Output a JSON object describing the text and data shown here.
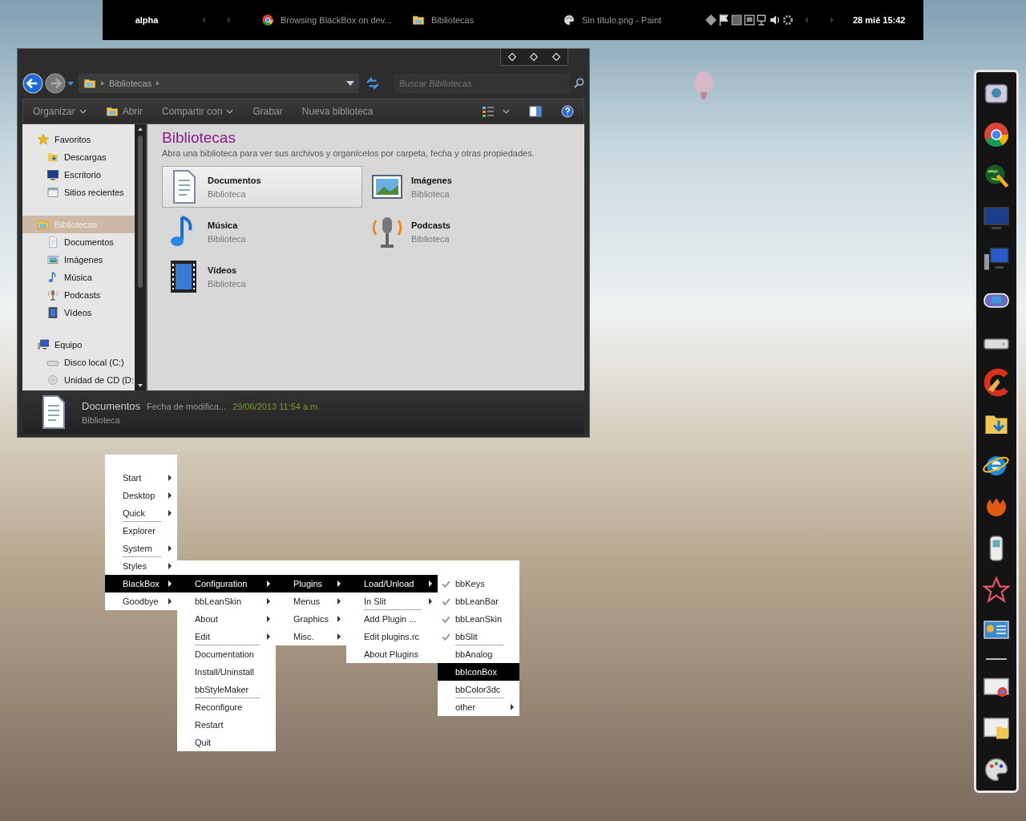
{
  "taskbar": {
    "workspace": "alpha",
    "tasks": [
      {
        "label": "Browsing BlackBox on dev...",
        "kind": "browser"
      },
      {
        "label": "Bibliotecas",
        "kind": "library"
      },
      {
        "label": "Sin título.png - Paint",
        "kind": "paint"
      }
    ],
    "clock": "28 mié 15:42"
  },
  "explorer": {
    "address": "Bibliotecas",
    "search": {
      "placeholder": "Buscar Bibliotecas"
    },
    "toolbar": [
      {
        "label": "Organizar",
        "kind": "dropdown"
      },
      {
        "label": "Abrir",
        "kind": "icon"
      },
      {
        "label": "Compartir con",
        "kind": "dropdown"
      },
      {
        "label": "Grabar",
        "kind": "plain"
      },
      {
        "label": "Nueva biblioteca",
        "kind": "plain"
      }
    ],
    "nav": [
      {
        "label": "Favoritos",
        "kind": "star",
        "selected": false,
        "children": [
          {
            "label": "Descargas",
            "kind": "download",
            "selected": false
          },
          {
            "label": "Escritorio",
            "kind": "desktop",
            "selected": false
          },
          {
            "label": "Sitios recientes",
            "kind": "recent",
            "selected": false
          }
        ]
      },
      {
        "label": "Bibliotecas",
        "kind": "library",
        "selected": true,
        "children": [
          {
            "label": "Documentos",
            "kind": "documents",
            "selected": false
          },
          {
            "label": "Imágenes",
            "kind": "pictures",
            "selected": false
          },
          {
            "label": "Música",
            "kind": "music",
            "selected": false
          },
          {
            "label": "Podcasts",
            "kind": "podcasts",
            "selected": false
          },
          {
            "label": "Vídeos",
            "kind": "videos",
            "selected": false
          }
        ]
      },
      {
        "label": "Equipo",
        "kind": "computer",
        "selected": false,
        "children": [
          {
            "label": "Disco local (C:)",
            "kind": "drive",
            "selected": false
          },
          {
            "label": "Unidad de CD (D:",
            "kind": "cd",
            "selected": false
          }
        ]
      }
    ],
    "heading": "Bibliotecas",
    "description": "Abra una biblioteca para ver sus archivos y organícelos por carpeta, fecha y otras propiedades.",
    "libraries": [
      {
        "name": "Documentos",
        "type": "Biblioteca",
        "kind": "documents",
        "selected": true
      },
      {
        "name": "Imágenes",
        "type": "Biblioteca",
        "kind": "pictures",
        "selected": false
      },
      {
        "name": "Música",
        "type": "Biblioteca",
        "kind": "music",
        "selected": false
      },
      {
        "name": "Podcasts",
        "type": "Biblioteca",
        "kind": "podcasts",
        "selected": false
      },
      {
        "name": "Vídeos",
        "type": "Biblioteca",
        "kind": "videos",
        "selected": false
      }
    ],
    "details": {
      "name": "Documentos",
      "field": "Fecha de modifica...",
      "value": "29/06/2013 11:54 a.m.",
      "type": "Biblioteca"
    }
  },
  "menus": [
    {
      "items": [
        {
          "label": "Start",
          "submenu": true,
          "separator": false,
          "selected": false
        },
        {
          "label": "Desktop",
          "submenu": true,
          "separator": false,
          "selected": false
        },
        {
          "label": "Quick",
          "submenu": true,
          "separator": true,
          "selected": false
        },
        {
          "label": "Explorer",
          "submenu": false,
          "separator": false,
          "selected": false
        },
        {
          "label": "System",
          "submenu": true,
          "separator": true,
          "selected": false
        },
        {
          "label": "Styles",
          "submenu": true,
          "separator": false,
          "selected": false
        },
        {
          "label": "BlackBox",
          "submenu": true,
          "separator": false,
          "selected": true
        },
        {
          "label": "Goodbye",
          "submenu": true,
          "separator": false,
          "selected": false
        }
      ]
    },
    {
      "items": [
        {
          "label": "Configuration",
          "submenu": true,
          "separator": false,
          "selected": true
        },
        {
          "label": "bbLeanSkin",
          "submenu": true,
          "separator": false,
          "selected": false
        },
        {
          "label": "About",
          "submenu": true,
          "separator": false,
          "selected": false
        },
        {
          "label": "Edit",
          "submenu": true,
          "separator": true,
          "selected": false
        },
        {
          "label": "Documentation",
          "submenu": false,
          "separator": false,
          "selected": false
        },
        {
          "label": "Install/Uninstall",
          "submenu": false,
          "separator": false,
          "selected": false
        },
        {
          "label": "bbStyleMaker",
          "submenu": false,
          "separator": true,
          "selected": false
        },
        {
          "label": "Reconfigure",
          "submenu": false,
          "separator": false,
          "selected": false
        },
        {
          "label": "Restart",
          "submenu": false,
          "separator": false,
          "selected": false
        },
        {
          "label": "Quit",
          "submenu": false,
          "separator": false,
          "selected": false
        }
      ]
    },
    {
      "items": [
        {
          "label": "Plugins",
          "submenu": true,
          "separator": false,
          "selected": true
        },
        {
          "label": "Menus",
          "submenu": true,
          "separator": false,
          "selected": false
        },
        {
          "label": "Graphics",
          "submenu": true,
          "separator": false,
          "selected": false
        },
        {
          "label": "Misc.",
          "submenu": true,
          "separator": false,
          "selected": false
        }
      ]
    },
    {
      "items": [
        {
          "label": "Load/Unload",
          "submenu": true,
          "separator": false,
          "selected": true
        },
        {
          "label": "In Slit",
          "submenu": true,
          "separator": true,
          "selected": false
        },
        {
          "label": "Add Plugin ...",
          "submenu": false,
          "separator": false,
          "selected": false
        },
        {
          "label": "Edit plugins.rc",
          "submenu": false,
          "separator": false,
          "selected": false
        },
        {
          "label": "About Plugins",
          "submenu": false,
          "separator": false,
          "selected": false
        }
      ]
    },
    {
      "items": [
        {
          "label": "bbKeys",
          "submenu": false,
          "separator": false,
          "selected": false,
          "checked": true
        },
        {
          "label": "bbLeanBar",
          "submenu": false,
          "separator": false,
          "selected": false,
          "checked": true
        },
        {
          "label": "bbLeanSkin",
          "submenu": false,
          "separator": false,
          "selected": false,
          "checked": true
        },
        {
          "label": "bbSlit",
          "submenu": false,
          "separator": true,
          "selected": false,
          "checked": true
        },
        {
          "label": "bbAnalog",
          "submenu": false,
          "separator": false,
          "selected": false,
          "checked": false
        },
        {
          "label": "bbIconBox",
          "submenu": false,
          "separator": false,
          "selected": true,
          "checked": false
        },
        {
          "label": "bbColor3dc",
          "submenu": false,
          "separator": true,
          "selected": false,
          "checked": false
        },
        {
          "label": "other",
          "submenu": true,
          "separator": false,
          "selected": false,
          "checked": false
        }
      ]
    }
  ]
}
